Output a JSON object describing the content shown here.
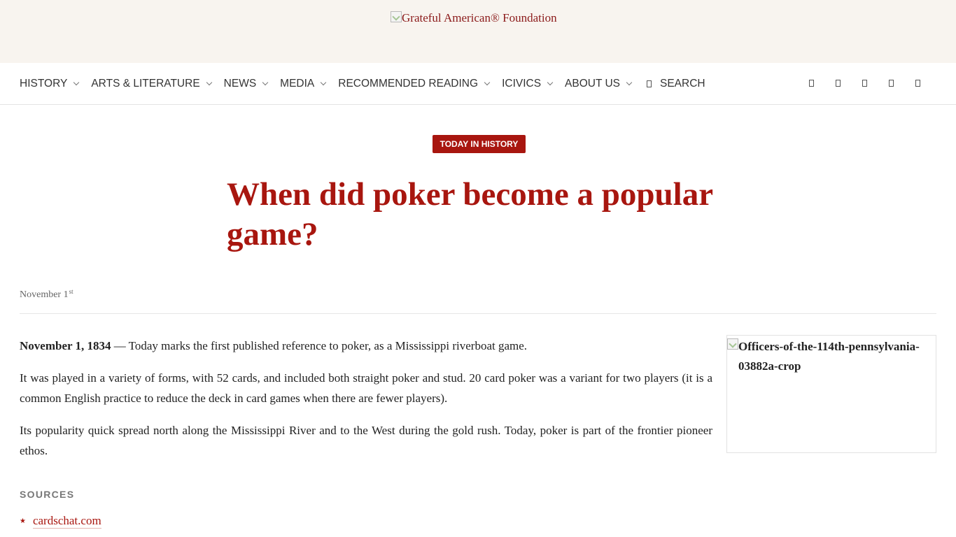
{
  "header": {
    "logo_alt": "Grateful American® Foundation"
  },
  "nav": {
    "items": [
      {
        "label": "HISTORY"
      },
      {
        "label": "ARTS & LITERATURE"
      },
      {
        "label": "NEWS"
      },
      {
        "label": "MEDIA"
      },
      {
        "label": "RECOMMENDED READING"
      },
      {
        "label": "ICIVICS"
      },
      {
        "label": "ABOUT US"
      }
    ],
    "search_label": "SEARCH",
    "social_icons": [
      "social-icon",
      "social-icon",
      "social-icon",
      "social-icon",
      "social-icon"
    ]
  },
  "article": {
    "category": "TODAY IN HISTORY",
    "title": "When did poker become a popular game?",
    "date": "November 1",
    "date_suffix": "st",
    "lead_date": "November 1, 1834",
    "lead_text": " — Today marks the first published reference to poker, as a Mississippi riverboat game.",
    "paragraph_2": "It was played in a variety of forms, with 52 cards, and included both straight poker and stud. 20 card poker was a variant for two players (it is a common English practice to reduce the deck in card games when there are fewer players).",
    "paragraph_3": "Its popularity quick spread north along the Mississippi River and to the West during the gold rush. Today, poker is part of the frontier pioneer ethos.",
    "image_alt": "Officers-of-the-114th-pennsylvania-03882a-crop"
  },
  "sources": {
    "heading": "SOURCES",
    "items": [
      {
        "label": "cardschat.com"
      }
    ]
  },
  "colors": {
    "accent": "#a8160f",
    "header_bg": "#f8f4ef"
  }
}
